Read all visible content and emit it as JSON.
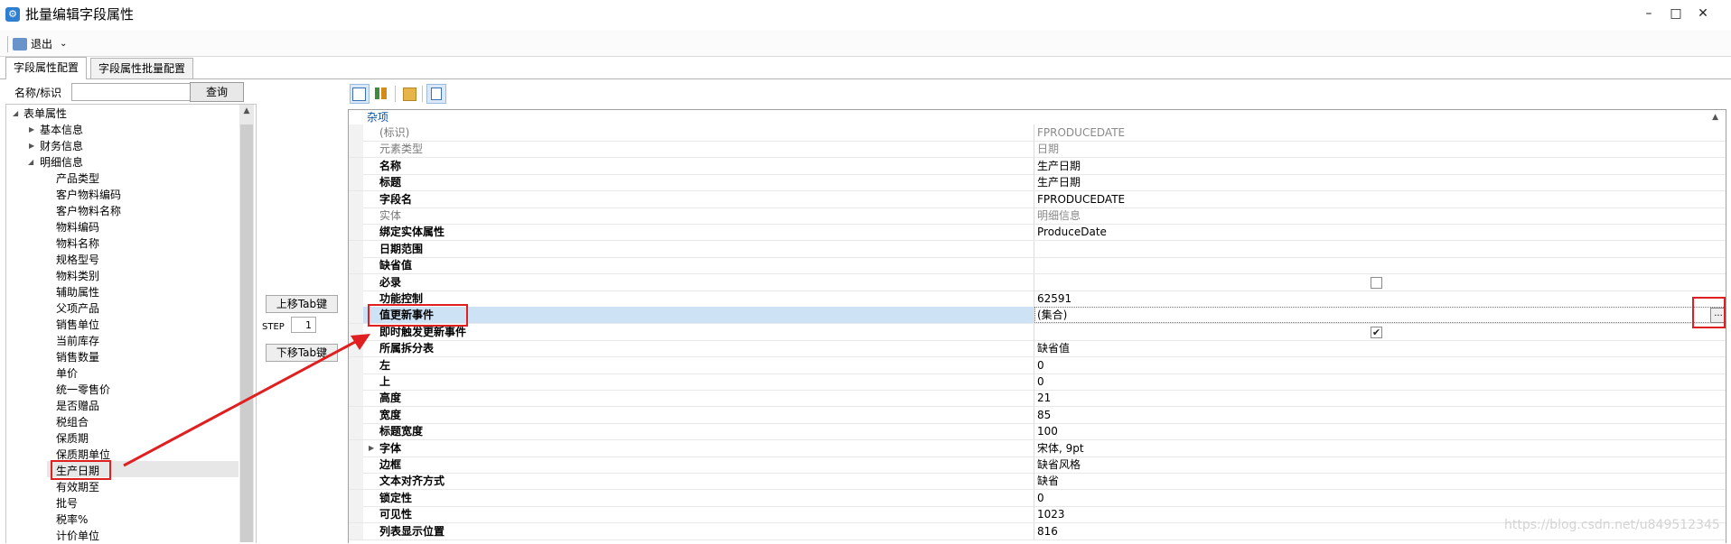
{
  "window": {
    "title": "批量编辑字段属性",
    "app_icon": "app-icon"
  },
  "toolbar": {
    "exit_label": "退出"
  },
  "tabs": [
    {
      "label": "字段属性配置",
      "active": true
    },
    {
      "label": "字段属性批量配置",
      "active": false
    }
  ],
  "search": {
    "label": "名称/标识",
    "value": "",
    "button": "查询"
  },
  "tree": {
    "root": "表单属性",
    "groups": [
      "基本信息",
      "财务信息",
      "明细信息"
    ],
    "detail_items": [
      "产品类型",
      "客户物料编码",
      "客户物料名称",
      "物料编码",
      "物料名称",
      "规格型号",
      "物料类别",
      "辅助属性",
      "父项产品",
      "销售单位",
      "当前库存",
      "销售数量",
      "单价",
      "统一零售价",
      "是否赠品",
      "税组合",
      "保质期",
      "保质期单位",
      "生产日期",
      "有效期至",
      "批号",
      "税率%",
      "计价单位"
    ],
    "selected": "生产日期"
  },
  "middle": {
    "up_button": "上移Tab键",
    "step_label": "STEP",
    "step_value": "1",
    "down_button": "下移Tab键"
  },
  "property_grid": {
    "category": "杂项",
    "rows": [
      {
        "name": "(标识)",
        "value": "FPRODUCEDATE",
        "dim": true
      },
      {
        "name": "元素类型",
        "value": "日期",
        "dim": true
      },
      {
        "name": "名称",
        "value": "生产日期"
      },
      {
        "name": "标题",
        "value": "生产日期"
      },
      {
        "name": "字段名",
        "value": "FPRODUCEDATE"
      },
      {
        "name": "实体",
        "value": "明细信息",
        "dim": true
      },
      {
        "name": "绑定实体属性",
        "value": "ProduceDate"
      },
      {
        "name": "日期范围",
        "value": ""
      },
      {
        "name": "缺省值",
        "value": ""
      },
      {
        "name": "必录",
        "value": "",
        "checkbox": true,
        "checked": false
      },
      {
        "name": "功能控制",
        "value": "62591"
      },
      {
        "name": "值更新事件",
        "value": "(集合)",
        "selected": true
      },
      {
        "name": "即时触发更新事件",
        "value": "",
        "checkbox": true,
        "checked": true
      },
      {
        "name": "所属拆分表",
        "value": "缺省值"
      },
      {
        "name": "左",
        "value": "0"
      },
      {
        "name": "上",
        "value": "0"
      },
      {
        "name": "高度",
        "value": "21"
      },
      {
        "name": "宽度",
        "value": "85"
      },
      {
        "name": "标题宽度",
        "value": "100"
      },
      {
        "name": "字体",
        "value": "宋体, 9pt",
        "expandable": true
      },
      {
        "name": "边框",
        "value": "缺省风格"
      },
      {
        "name": "文本对齐方式",
        "value": "缺省"
      },
      {
        "name": "锁定性",
        "value": "0"
      },
      {
        "name": "可见性",
        "value": "1023"
      },
      {
        "name": "列表显示位置",
        "value": "816"
      }
    ],
    "ellipsis_button": "..."
  },
  "watermark": "https://blog.csdn.net/u849512345"
}
